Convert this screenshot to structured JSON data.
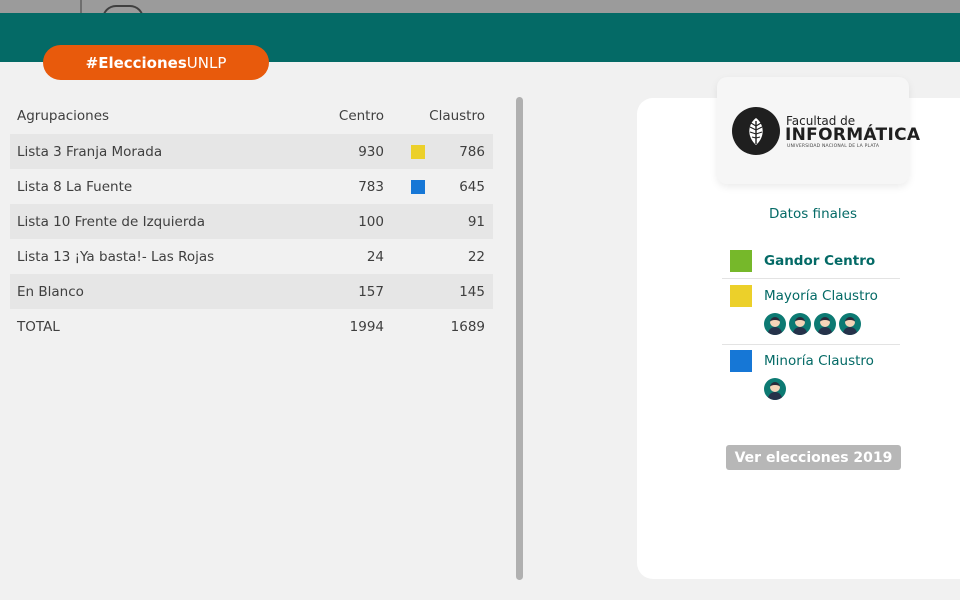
{
  "hashtag": {
    "bold": "#Elecciones",
    "rest": "UNLP"
  },
  "results": {
    "headers": {
      "name": "Agrupaciones",
      "centro": "Centro",
      "claustro": "Claustro"
    },
    "rows": [
      {
        "name": "Lista 3 Franja Morada",
        "centro": "930",
        "claustro": "786",
        "marker": "yellow"
      },
      {
        "name": "Lista 8 La Fuente",
        "centro": "783",
        "claustro": "645",
        "marker": "blue"
      },
      {
        "name": "Lista 10 Frente de Izquierda",
        "centro": "100",
        "claustro": "91",
        "marker": ""
      },
      {
        "name": "Lista 13 ¡Ya basta!- Las Rojas",
        "centro": "24",
        "claustro": "22",
        "marker": ""
      },
      {
        "name": "En Blanco",
        "centro": "157",
        "claustro": "145",
        "marker": ""
      },
      {
        "name": "TOTAL",
        "centro": "1994",
        "claustro": "1689",
        "marker": ""
      }
    ]
  },
  "logo": {
    "line1": "Facultad de",
    "line2": "INFORMÁTICA",
    "line3": "UNIVERSIDAD NACIONAL DE LA PLATA"
  },
  "final": {
    "title": "Datos finales",
    "items": [
      {
        "label": "Gandor Centro",
        "color": "#76b82a",
        "seats": 0
      },
      {
        "label": "Mayoría Claustro",
        "color": "#ecd02a",
        "seats": 4
      },
      {
        "label": "Minoría Claustro",
        "color": "#1677d6",
        "seats": 1
      }
    ]
  },
  "button": {
    "label": "Ver elecciones 2019"
  },
  "colors": {
    "header": "#046a66",
    "accent": "#e85a0c",
    "yellow": "#ecd02a",
    "blue": "#1677d6",
    "green": "#76b82a"
  }
}
